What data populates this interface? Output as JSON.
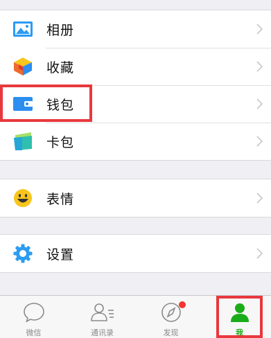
{
  "menu": {
    "album": "相册",
    "favorites": "收藏",
    "wallet": "钱包",
    "cards": "卡包",
    "stickers": "表情",
    "settings": "设置"
  },
  "tabbar": {
    "chats": "微信",
    "contacts": "通讯录",
    "discover": "发现",
    "me": "我"
  },
  "colors": {
    "highlight": "#e8383d",
    "active_tab": "#1aad19",
    "badge": "#f43530",
    "album_icon": "#2b9bf4",
    "wallet_icon": "#2b8ef0",
    "settings_icon": "#2d9cf0",
    "sticker_icon": "#f7c51d"
  },
  "icons": {
    "album": "image-icon",
    "favorites": "cube-icon",
    "wallet": "wallet-icon",
    "cards": "card-icon",
    "stickers": "smile-icon",
    "settings": "gear-icon",
    "chats": "chat-bubble-icon",
    "contacts": "contacts-icon",
    "discover": "compass-icon",
    "me": "person-icon"
  }
}
